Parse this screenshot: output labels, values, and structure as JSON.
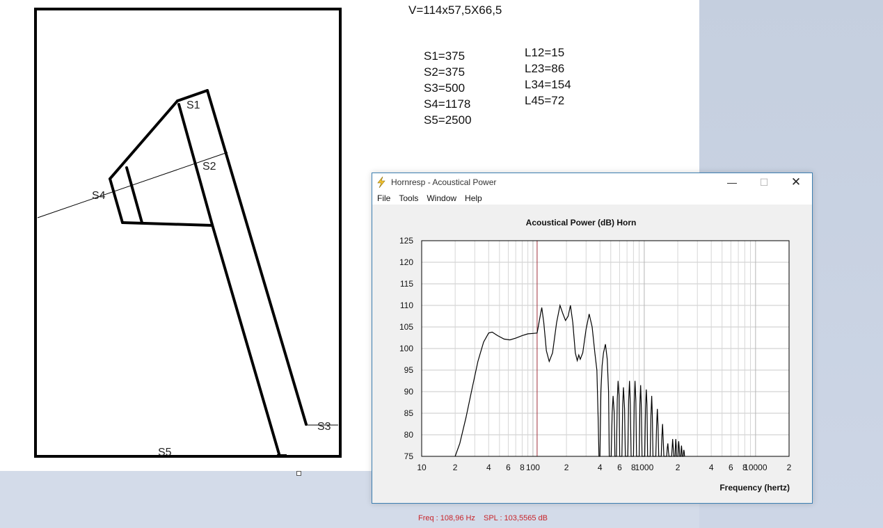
{
  "document": {
    "volume": "V=114x57,5X66,5",
    "sections": [
      "S1=375",
      "S2=375",
      "S3=500",
      "S4=1178",
      "S5=2500"
    ],
    "lengths": [
      "L12=15",
      "L23=86",
      "L34=154",
      "L45=72"
    ],
    "drawing_labels": {
      "s1": "S1",
      "s2": "S2",
      "s3": "S3",
      "s4": "S4",
      "s5": "S5"
    }
  },
  "window": {
    "title": "Hornresp - Acoustical Power",
    "menu": [
      "File",
      "Tools",
      "Window",
      "Help"
    ],
    "controls": {
      "minimize": "—",
      "maximize": "☐",
      "close": "✕"
    },
    "status": {
      "freq": "Freq : 108,96 Hz",
      "spl": "SPL : 103,5565 dB"
    },
    "icon": "lightning-icon"
  },
  "chart_data": {
    "type": "line",
    "title": "Acoustical Power (dB)    Horn",
    "xlabel": "Frequency (hertz)",
    "ylabel": "",
    "x_scale": "log",
    "xlim": [
      10,
      20000
    ],
    "ylim": [
      75,
      125
    ],
    "yticks": [
      75,
      80,
      85,
      90,
      95,
      100,
      105,
      110,
      115,
      120,
      125
    ],
    "xtick_labels": [
      "10",
      "2",
      "4",
      "6",
      "8",
      "100",
      "2",
      "4",
      "6",
      "8",
      "1000",
      "2",
      "4",
      "6",
      "8",
      "10000",
      "2"
    ],
    "marker_frequency": 108.96,
    "grid": true,
    "colors": {
      "line": "#000000",
      "marker": "#a0303a",
      "grid": "#c8c8c8",
      "status": "#c8242a"
    },
    "series": [
      {
        "values": [
          [
            20,
            75
          ],
          [
            22,
            78
          ],
          [
            25,
            84
          ],
          [
            28,
            90
          ],
          [
            32,
            97
          ],
          [
            36,
            101.5
          ],
          [
            40,
            103.6
          ],
          [
            43,
            103.8
          ],
          [
            48,
            103
          ],
          [
            55,
            102.2
          ],
          [
            62,
            102
          ],
          [
            70,
            102.4
          ],
          [
            80,
            103
          ],
          [
            90,
            103.4
          ],
          [
            100,
            103.5
          ],
          [
            109,
            103.6
          ],
          [
            115,
            107
          ],
          [
            120,
            109.5
          ],
          [
            125,
            106
          ],
          [
            132,
            99.5
          ],
          [
            140,
            97
          ],
          [
            150,
            99
          ],
          [
            163,
            106
          ],
          [
            175,
            110
          ],
          [
            186,
            108
          ],
          [
            196,
            106.5
          ],
          [
            207,
            107.5
          ],
          [
            217,
            110
          ],
          [
            228,
            106
          ],
          [
            240,
            99
          ],
          [
            250,
            97.2
          ],
          [
            258,
            98.5
          ],
          [
            266,
            97.5
          ],
          [
            280,
            99
          ],
          [
            300,
            104.5
          ],
          [
            320,
            108
          ],
          [
            340,
            105
          ],
          [
            360,
            99
          ],
          [
            375,
            95
          ],
          [
            385,
            84
          ],
          [
            392,
            75
          ],
          [
            400,
            75
          ],
          [
            408,
            90
          ],
          [
            418,
            96
          ],
          [
            430,
            99
          ],
          [
            448,
            101
          ],
          [
            465,
            97.5
          ],
          [
            478,
            90
          ],
          [
            485,
            75
          ],
          [
            505,
            75
          ],
          [
            515,
            85
          ],
          [
            525,
            89
          ],
          [
            538,
            85
          ],
          [
            545,
            75
          ],
          [
            562,
            75
          ],
          [
            572,
            88
          ],
          [
            582,
            92.5
          ],
          [
            594,
            89
          ],
          [
            602,
            75
          ],
          [
            630,
            75
          ],
          [
            640,
            87
          ],
          [
            650,
            91
          ],
          [
            665,
            86
          ],
          [
            676,
            75
          ],
          [
            712,
            75
          ],
          [
            724,
            88
          ],
          [
            737,
            92.5
          ],
          [
            750,
            87
          ],
          [
            762,
            75
          ],
          [
            800,
            75
          ],
          [
            813,
            87.5
          ],
          [
            826,
            92.5
          ],
          [
            840,
            88
          ],
          [
            852,
            75
          ],
          [
            900,
            75
          ],
          [
            914,
            87
          ],
          [
            928,
            91.5
          ],
          [
            943,
            86
          ],
          [
            955,
            75
          ],
          [
            1010,
            75
          ],
          [
            1026,
            86
          ],
          [
            1042,
            90.5
          ],
          [
            1058,
            87
          ],
          [
            1072,
            75
          ],
          [
            1130,
            75
          ],
          [
            1148,
            84.5
          ],
          [
            1166,
            89
          ],
          [
            1182,
            84.5
          ],
          [
            1198,
            75
          ],
          [
            1270,
            75
          ],
          [
            1290,
            82
          ],
          [
            1310,
            86
          ],
          [
            1330,
            82
          ],
          [
            1350,
            75
          ],
          [
            1420,
            75
          ],
          [
            1440,
            79.5
          ],
          [
            1460,
            82.5
          ],
          [
            1480,
            79
          ],
          [
            1500,
            75
          ],
          [
            1590,
            75
          ],
          [
            1610,
            77
          ],
          [
            1630,
            78
          ],
          [
            1650,
            76
          ],
          [
            1670,
            75
          ],
          [
            1760,
            75
          ],
          [
            1780,
            77
          ],
          [
            1800,
            79
          ],
          [
            1820,
            77
          ],
          [
            1840,
            75
          ],
          [
            1890,
            75
          ],
          [
            1905,
            77.5
          ],
          [
            1920,
            79
          ],
          [
            1935,
            77.5
          ],
          [
            1950,
            75
          ],
          [
            2010,
            75
          ],
          [
            2025,
            77.5
          ],
          [
            2040,
            78.5
          ],
          [
            2060,
            77
          ],
          [
            2080,
            75
          ],
          [
            2130,
            75
          ],
          [
            2145,
            76.5
          ],
          [
            2160,
            77.5
          ],
          [
            2175,
            76.5
          ],
          [
            2190,
            75
          ],
          [
            2240,
            75
          ],
          [
            2255,
            76
          ],
          [
            2270,
            76.5
          ],
          [
            2285,
            76
          ],
          [
            2300,
            75
          ]
        ]
      }
    ]
  }
}
